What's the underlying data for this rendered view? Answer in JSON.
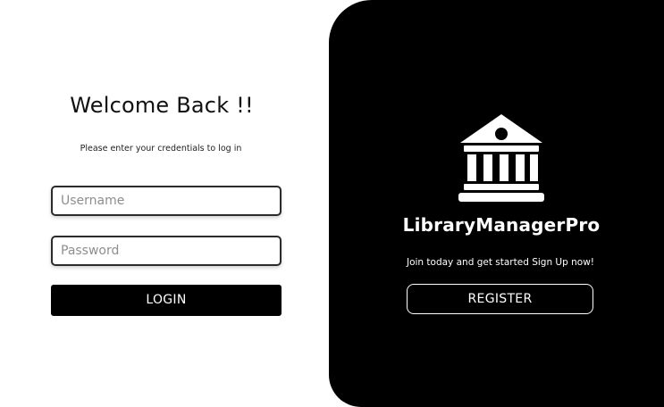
{
  "login": {
    "title": "Welcome Back !!",
    "subtitle": "Please enter your credentials to log in",
    "username": {
      "value": "",
      "placeholder": "Username"
    },
    "password": {
      "value": "",
      "placeholder": "Password"
    },
    "login_label": "LOGIN"
  },
  "brand": {
    "logo_icon": "library-building-icon",
    "name": "LibraryManagerPro",
    "tagline": "Join today and get started Sign Up now!",
    "register_label": "REGISTER"
  },
  "colors": {
    "background": "#ffffff",
    "panel": "#000000",
    "accent_text": "#ffffff"
  }
}
